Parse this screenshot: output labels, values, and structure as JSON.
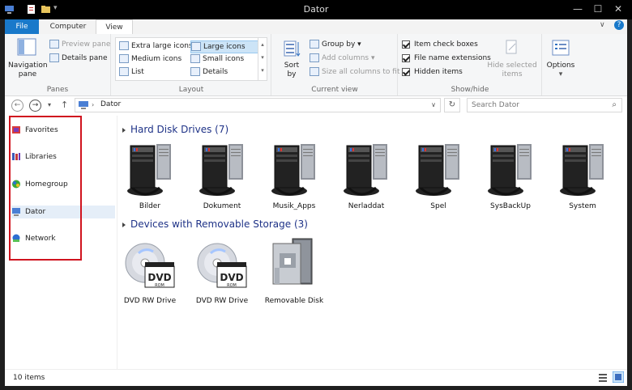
{
  "window": {
    "title": "Dator"
  },
  "tabs": [
    {
      "id": "file",
      "label": "File"
    },
    {
      "id": "computer",
      "label": "Computer"
    },
    {
      "id": "view",
      "label": "View"
    }
  ],
  "ribbon": {
    "panes": {
      "label": "Panes",
      "navigation_pane": "Navigation",
      "navigation_pane_2": "pane",
      "preview_pane": "Preview pane",
      "details_pane": "Details pane"
    },
    "layout": {
      "label": "Layout",
      "items": [
        "Extra large icons",
        "Large icons",
        "Medium icons",
        "Small icons",
        "List",
        "Details"
      ],
      "selected": "Large icons"
    },
    "current_view": {
      "label": "Current view",
      "sort_by": "Sort",
      "sort_by_2": "by",
      "group_by": "Group by",
      "add_columns": "Add columns",
      "size_all_columns": "Size all columns to fit"
    },
    "show_hide": {
      "label": "Show/hide",
      "item_check_boxes": "Item check boxes",
      "file_name_extensions": "File name extensions",
      "hidden_items": "Hidden items",
      "hide_selected": "Hide selected",
      "hide_selected_2": "items"
    },
    "options": {
      "label": "Options"
    }
  },
  "address": {
    "location": "Dator",
    "search_placeholder": "Search Dator"
  },
  "nav": [
    {
      "label": "Favorites",
      "icon": "favorites-icon"
    },
    {
      "label": "Libraries",
      "icon": "libraries-icon"
    },
    {
      "label": "Homegroup",
      "icon": "homegroup-icon"
    },
    {
      "label": "Dator",
      "icon": "computer-icon"
    },
    {
      "label": "Network",
      "icon": "network-icon"
    }
  ],
  "groups": [
    {
      "title": "Hard Disk Drives (7)",
      "items": [
        "Bilder",
        "Dokument",
        "Musik_Apps",
        "Nerladdat",
        "Spel",
        "SysBackUp",
        "System"
      ]
    },
    {
      "title": "Devices with Removable Storage (3)",
      "items": [
        "DVD RW Drive",
        "DVD RW Drive",
        "Removable Disk"
      ]
    }
  ],
  "status": {
    "count": "10 items"
  },
  "dvd_label": "DVD",
  "rom_label": "ROM",
  "colors": {
    "file_tab": "#1979ca",
    "group_header": "#1e3287",
    "highlight_box": "#d0141f"
  }
}
